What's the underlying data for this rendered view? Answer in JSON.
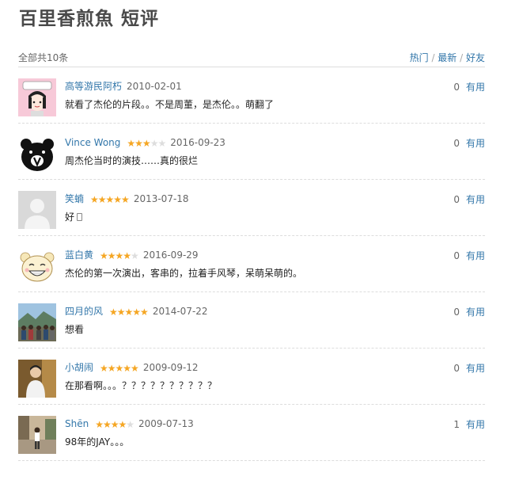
{
  "page": {
    "title": "百里香煎魚 短评"
  },
  "summary": {
    "count_label": "全部共10条"
  },
  "sort": {
    "hot": "热门",
    "separator": " / ",
    "latest": "最新",
    "friends": "好友"
  },
  "comments": [
    {
      "user": "高等游民阿朽",
      "rating": 0,
      "date": "2010-02-01",
      "text": "就看了杰伦的片段。。不是周董，是杰伦。。萌翻了",
      "votes": "0",
      "useful": "有用",
      "avatar": "cartoon-girl-avatar"
    },
    {
      "user": "Vince Wong",
      "rating": 3,
      "date": "2016-09-23",
      "text": "周杰伦当时的演技……真的很烂",
      "votes": "0",
      "useful": "有用",
      "avatar": "bear-v-avatar"
    },
    {
      "user": "笑蝻",
      "rating": 5,
      "date": "2013-07-18",
      "text": "好",
      "votes": "0",
      "useful": "有用",
      "avatar": "default-avatar"
    },
    {
      "user": "蓝白黄",
      "rating": 4,
      "date": "2016-09-29",
      "text": "杰伦的第一次演出，客串的，拉着手风琴，呆萌呆萌的。",
      "votes": "0",
      "useful": "有用",
      "avatar": "cartoon-face-avatar"
    },
    {
      "user": "四月的风",
      "rating": 5,
      "date": "2014-07-22",
      "text": "想看",
      "votes": "0",
      "useful": "有用",
      "avatar": "group-photo-avatar"
    },
    {
      "user": "小胡闹",
      "rating": 5,
      "date": "2009-09-12",
      "text": "在那看啊。。。？？？？？？？？？？",
      "votes": "0",
      "useful": "有用",
      "avatar": "person-photo-avatar"
    },
    {
      "user": "Shēn",
      "rating": 4,
      "date": "2009-07-13",
      "text": "98年的JAY。。。",
      "votes": "1",
      "useful": "有用",
      "avatar": "street-photo-avatar"
    }
  ],
  "colors": {
    "link": "#3377aa",
    "star": "#f5a623",
    "title": "#494949"
  }
}
